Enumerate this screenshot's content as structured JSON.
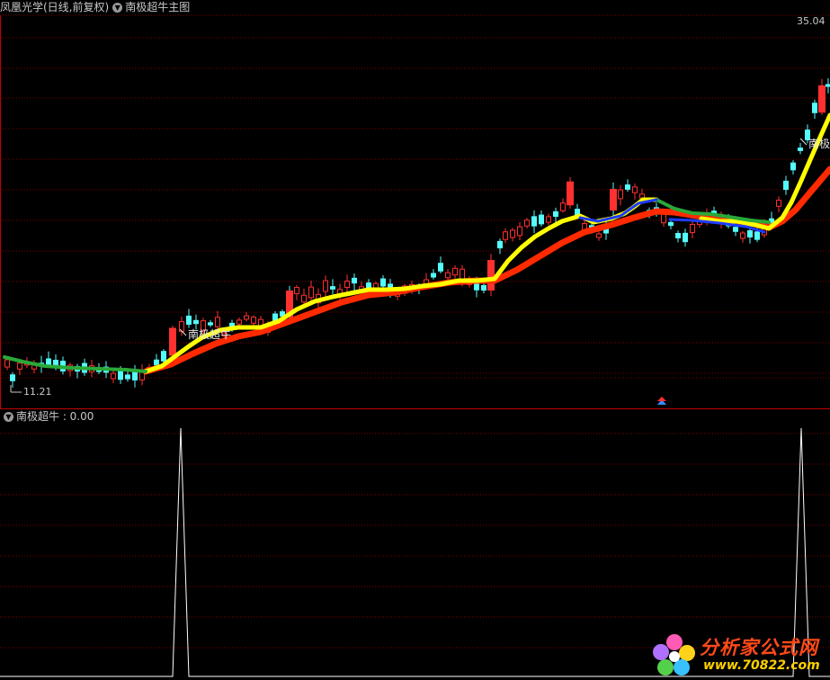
{
  "main": {
    "stock_title": "凤凰光学(日线,前复权)",
    "indicator_title": "南极超牛主图",
    "price_high": "35.04",
    "price_low": "11.21",
    "signal_label": "南极超牛",
    "signal_label_right": "南极"
  },
  "sub": {
    "indicator_title": "南极超牛 : 0.00"
  },
  "watermark": {
    "cn": "分析家公式网",
    "url": "www.70822.com"
  },
  "colors": {
    "up": "#ff3030",
    "down": "#54fcfc",
    "line_yellow": "#ffff00",
    "line_red": "#ff2a00",
    "line_green": "#2aa838",
    "line_blue": "#1e3cff",
    "grid": "#7a0000"
  }
}
